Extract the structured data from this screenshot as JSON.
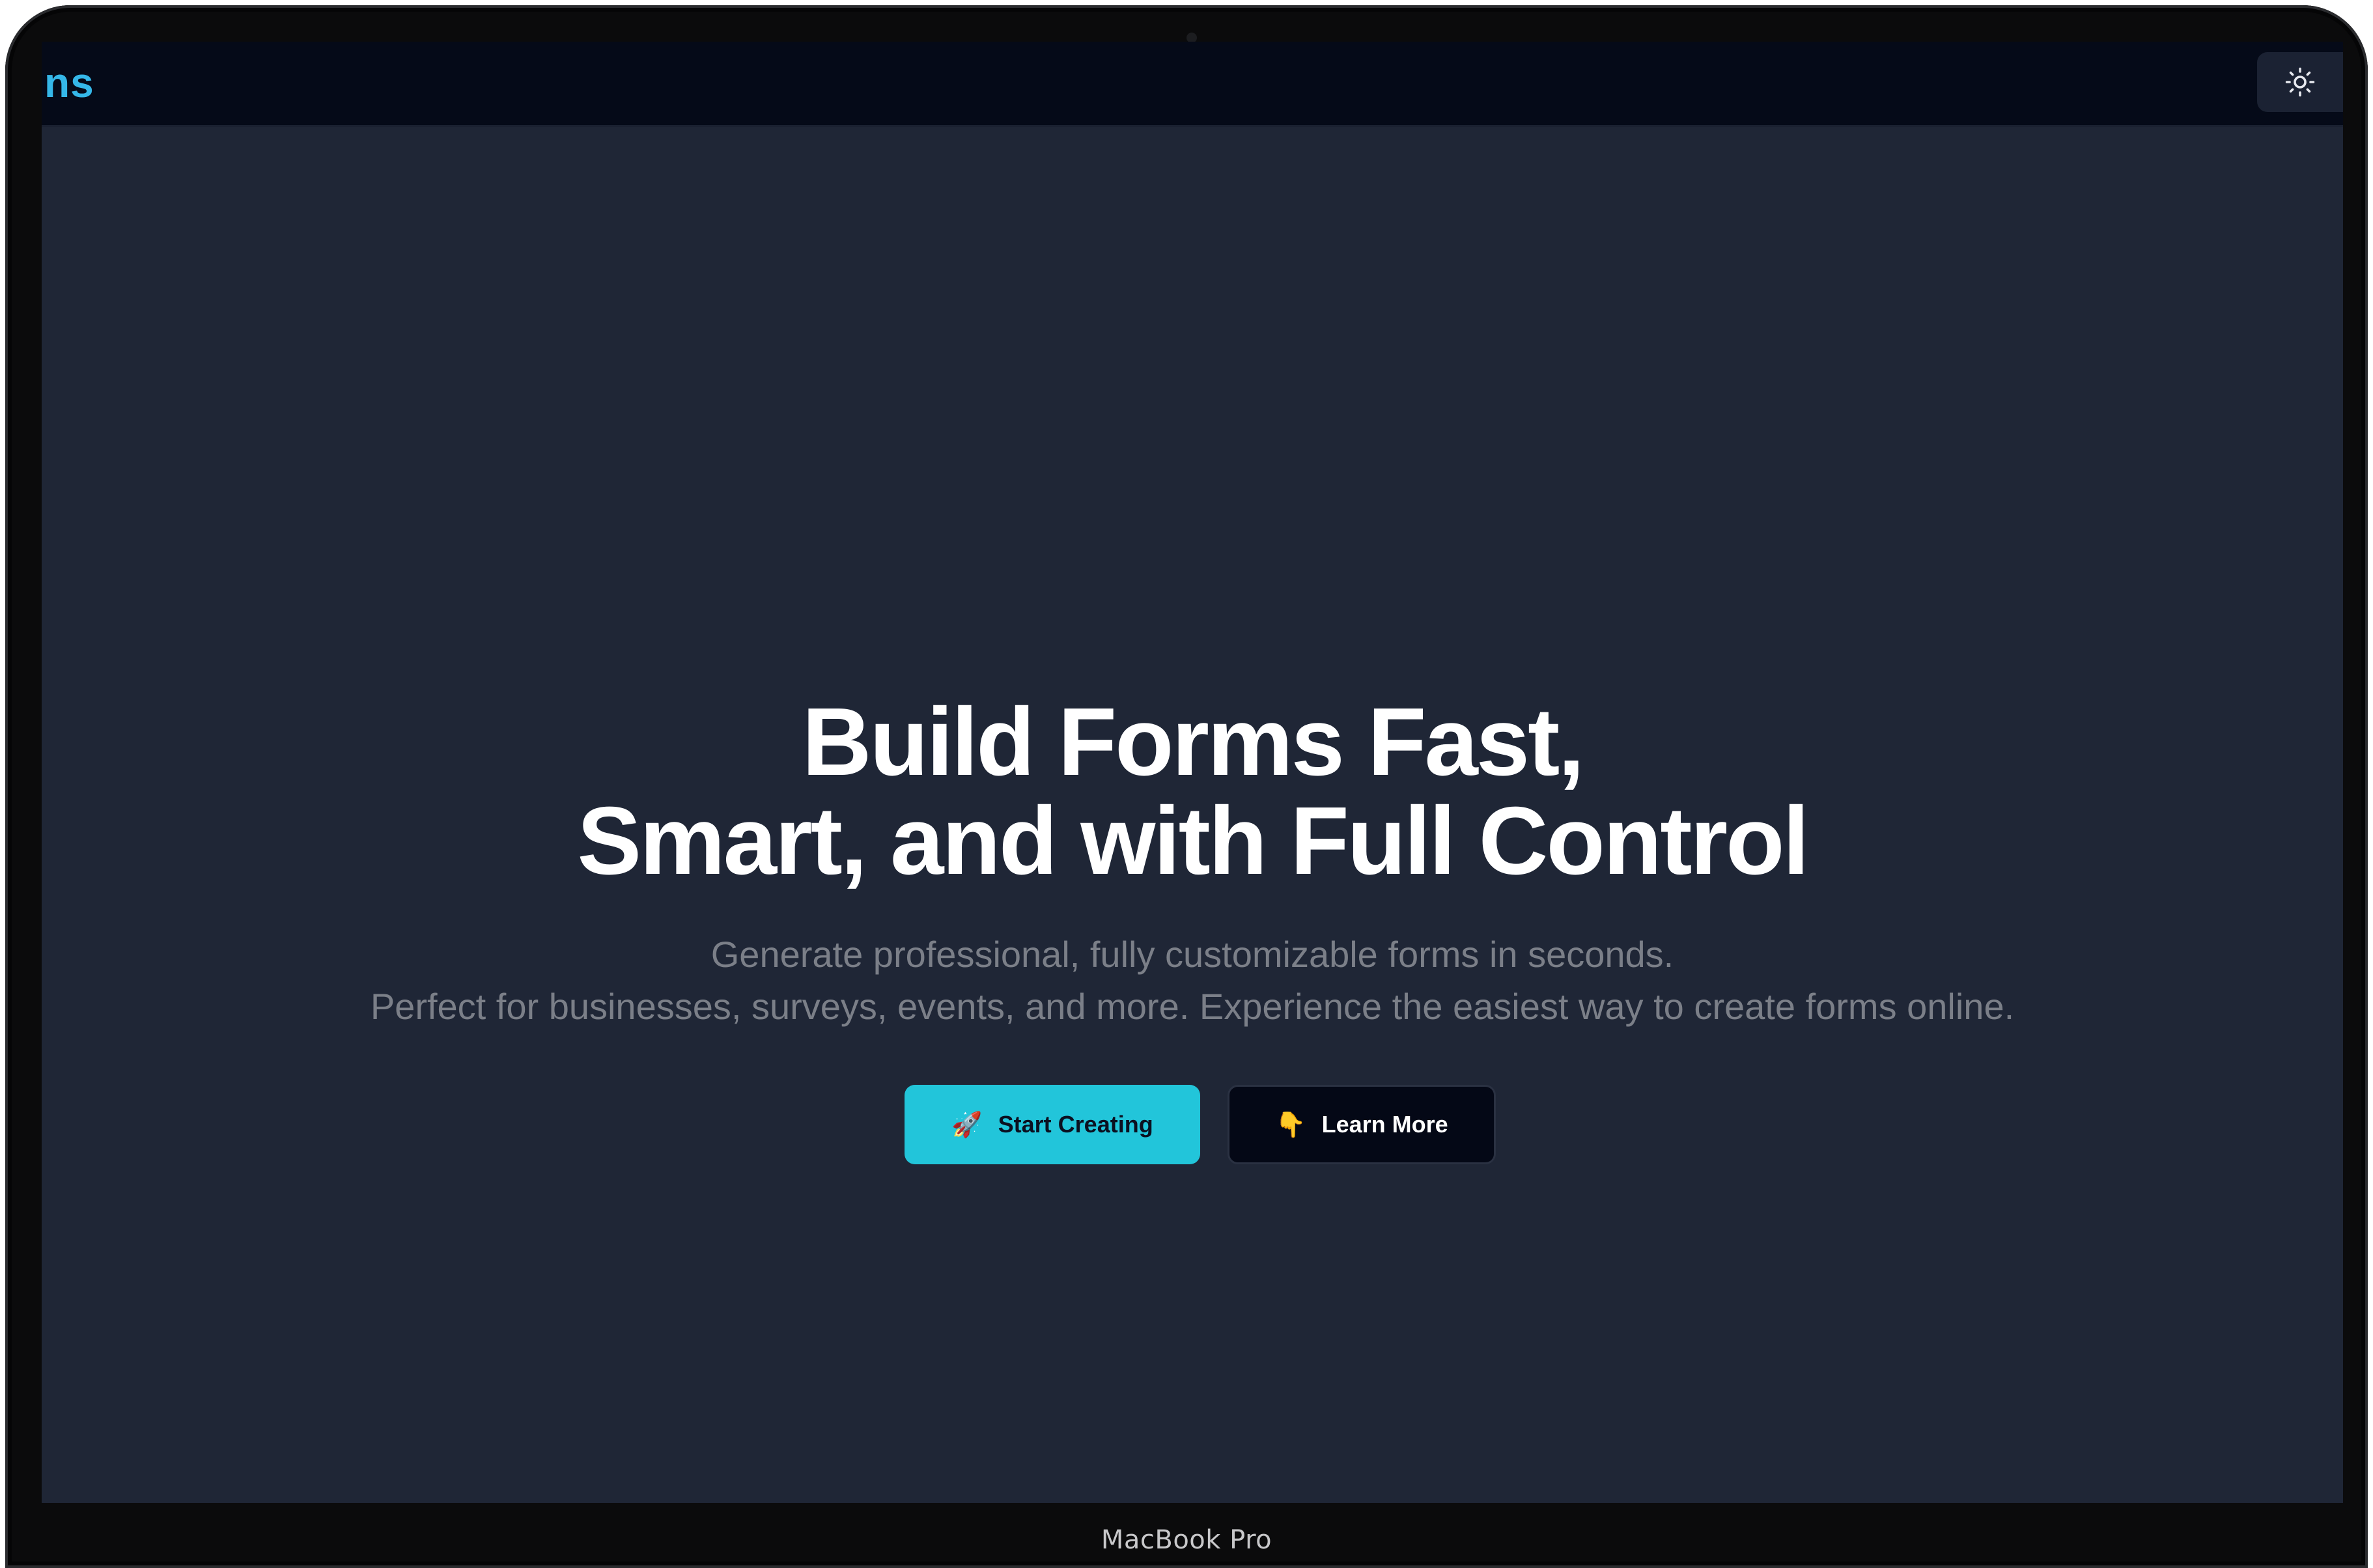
{
  "header": {
    "logo_text": "ns",
    "theme_toggle_icon": "sun-icon"
  },
  "hero": {
    "title_line_1": "Build Forms Fast,",
    "title_line_2": "Smart, and with Full Control",
    "subtitle_line_1": "Generate professional, fully customizable forms in seconds.",
    "subtitle_line_2": "Perfect for businesses, surveys, events, and more. Experience the easiest way to create forms online.",
    "primary_button": {
      "icon": "🚀",
      "label": "Start Creating"
    },
    "secondary_button": {
      "icon": "👇",
      "label": "Learn More"
    }
  },
  "device": {
    "label": "MacBook Pro"
  },
  "colors": {
    "background": "#040816",
    "accent": "#22c5da",
    "logo": "#35b7e8",
    "muted_text": "#7b7f88"
  }
}
